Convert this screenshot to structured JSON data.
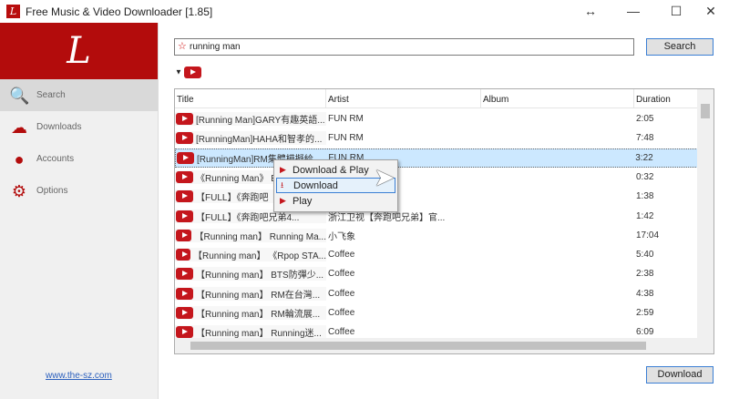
{
  "window": {
    "title": "Free Music & Video Downloader [1.85]",
    "logo_letter": "L",
    "resize_icon": "↔",
    "min": "—",
    "max": "☐",
    "close": "✕"
  },
  "sidebar": {
    "items": [
      {
        "label": "Search",
        "icon": "search-icon",
        "glyph": "🔍"
      },
      {
        "label": "Downloads",
        "icon": "cloud-download-icon",
        "glyph": "☁"
      },
      {
        "label": "Accounts",
        "icon": "user-icon",
        "glyph": "●"
      },
      {
        "label": "Options",
        "icon": "gear-icon",
        "glyph": "⚙"
      }
    ],
    "link": "www.the-sz.com"
  },
  "search": {
    "value": "running man",
    "button": "Search",
    "source_arrow": "▼"
  },
  "table": {
    "columns": [
      "Title",
      "Artist",
      "Album",
      "Duration"
    ],
    "rows": [
      {
        "title": "[Running Man]GARY有趣英語...",
        "artist": "FUN RM",
        "album": "",
        "duration": "2:05"
      },
      {
        "title": "[RunningMan]HAHA和智孝的...",
        "artist": "FUN RM",
        "album": "",
        "duration": "7:48"
      },
      {
        "title": "[RunningMan]RM集體模擬給...",
        "artist": "FUN RM",
        "album": "",
        "duration": "3:22"
      },
      {
        "title": "《Running Man》 E",
        "artist": "",
        "album": "",
        "duration": "0:32"
      },
      {
        "title": "【FULL】《奔跑吧",
        "artist": "跑吧兄弟】官...",
        "album": "",
        "duration": "1:38"
      },
      {
        "title": "【FULL】《奔跑吧兄弟4...",
        "artist": "浙江卫视【奔跑吧兄弟】官...",
        "album": "",
        "duration": "1:42"
      },
      {
        "title": "【Running man】 Running Ma...",
        "artist": "小飞象",
        "album": "",
        "duration": "17:04"
      },
      {
        "title": "【Running man】 《Rpop STA...",
        "artist": "Coffee",
        "album": "",
        "duration": "5:40"
      },
      {
        "title": "【Running man】 BTS防彈少...",
        "artist": "Coffee",
        "album": "",
        "duration": "2:38"
      },
      {
        "title": "【Running man】 RM在台灣...",
        "artist": "Coffee",
        "album": "",
        "duration": "4:38"
      },
      {
        "title": "【Running man】 RM輪流展...",
        "artist": "Coffee",
        "album": "",
        "duration": "2:59"
      },
      {
        "title": "【Running man】 Running迷...",
        "artist": "Coffee",
        "album": "",
        "duration": "6:09"
      }
    ],
    "selected_index": 2
  },
  "context_menu": {
    "items": [
      {
        "label": "Download & Play",
        "glyph": "▶"
      },
      {
        "label": "Download",
        "glyph": "⭳"
      },
      {
        "label": "Play",
        "glyph": "▶"
      }
    ],
    "highlighted_index": 1
  },
  "footer": {
    "download_button": "Download"
  }
}
